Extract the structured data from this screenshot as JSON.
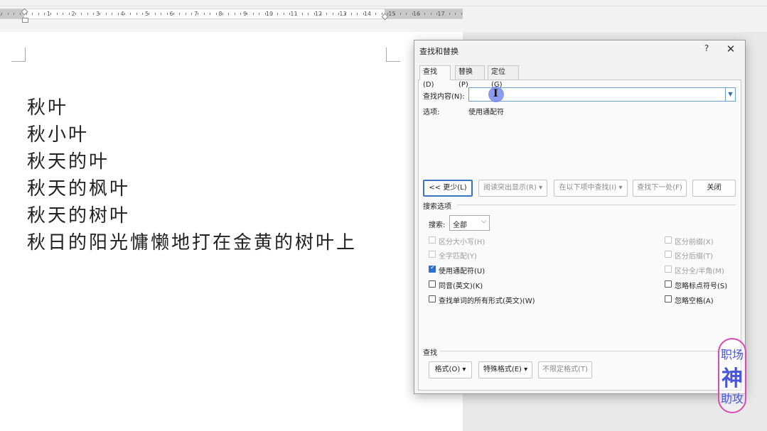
{
  "ruler": {
    "numbers": [
      "1",
      "1",
      "2",
      "3",
      "4",
      "5",
      "6",
      "7",
      "8",
      "9",
      "10",
      "11",
      "12",
      "13",
      "14",
      "15",
      "16",
      "17"
    ]
  },
  "document": {
    "lines": [
      "秋叶",
      "秋小叶",
      "秋天的叶",
      "秋天的枫叶",
      "秋天的树叶",
      "秋日的阳光慵懒地打在金黄的树叶上"
    ]
  },
  "dialog": {
    "title": "查找和替换",
    "help_label": "?",
    "close_label": "✕",
    "tabs": [
      {
        "label": "查找(D)",
        "active": true
      },
      {
        "label": "替换(P)",
        "active": false
      },
      {
        "label": "定位(G)",
        "active": false
      }
    ],
    "find_label": "查找内容(N):",
    "find_value": "",
    "options_label": "选项:",
    "options_value": "使用通配符",
    "buttons": {
      "less": "<< 更少(L)",
      "reading_highlight": "阅读突出显示(R) ▾",
      "find_in": "在以下项中查找(I) ▾",
      "find_next": "查找下一处(F)",
      "close": "关闭"
    },
    "search_options_title": "搜索选项",
    "search_label": "搜索:",
    "search_value": "全部",
    "left_options": [
      {
        "label": "区分大小写(H)",
        "checked": false,
        "disabled": true
      },
      {
        "label": "全字匹配(Y)",
        "checked": false,
        "disabled": true
      },
      {
        "label": "使用通配符(U)",
        "checked": true,
        "disabled": false
      },
      {
        "label": "同音(英文)(K)",
        "checked": false,
        "disabled": false
      },
      {
        "label": "查找单词的所有形式(英文)(W)",
        "checked": false,
        "disabled": false
      }
    ],
    "right_options": [
      {
        "label": "区分前缀(X)",
        "checked": false,
        "disabled": true
      },
      {
        "label": "区分后缀(T)",
        "checked": false,
        "disabled": true
      },
      {
        "label": "区分全/半角(M)",
        "checked": false,
        "disabled": true
      },
      {
        "label": "忽略标点符号(S)",
        "checked": false,
        "disabled": false
      },
      {
        "label": "忽略空格(A)",
        "checked": false,
        "disabled": false
      }
    ],
    "find_section_title": "查找",
    "format_buttons": {
      "format": "格式(O) ▾",
      "special": "特殊格式(E) ▾",
      "no_format": "不限定格式(T)"
    }
  },
  "watermark": {
    "line1": "职场",
    "line2": "神",
    "line3": "助攻"
  },
  "colors": {
    "checkbox_checked": "#2f6fcf",
    "stamp_border": "#d84bb0",
    "stamp_text": "#4a55d9"
  }
}
